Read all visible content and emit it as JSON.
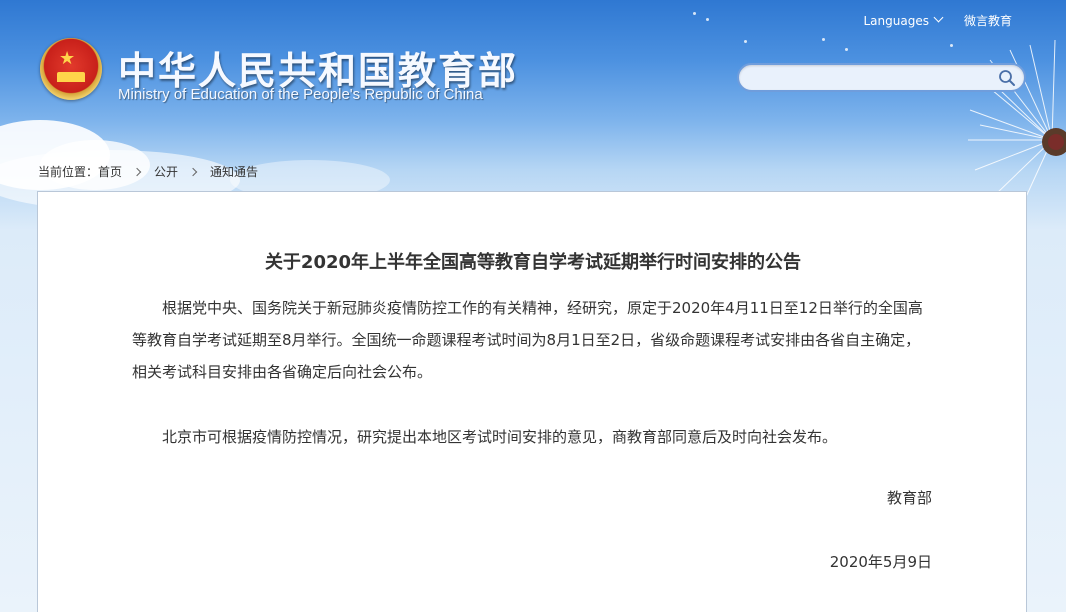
{
  "header": {
    "site_title": "中华人民共和国教育部",
    "site_subtitle": "Ministry of Education of the People's Republic of China",
    "languages_label": "Languages",
    "weibo_label": "微言教育",
    "emblem_icon": "national-emblem-icon"
  },
  "search": {
    "placeholder": "",
    "value": "",
    "icon": "search-icon"
  },
  "breadcrumb": {
    "prefix": "当前位置：",
    "items": [
      "首页",
      "公开",
      "通知通告"
    ]
  },
  "article": {
    "title": "关于2020年上半年全国高等教育自学考试延期举行时间安排的公告",
    "paragraphs": [
      "根据党中央、国务院关于新冠肺炎疫情防控工作的有关精神，经研究，原定于2020年4月11日至12日举行的全国高等教育自学考试延期至8月举行。全国统一命题课程考试时间为8月1日至2日，省级命题课程考试安排由各省自主确定，相关考试科目安排由各省确定后向社会公布。",
      "北京市可根据疫情防控情况，研究提出本地区考试时间安排的意见，商教育部同意后及时向社会发布。"
    ],
    "signature": "教育部",
    "date": "2020年5月9日"
  },
  "colors": {
    "sky_top": "#2f78d2",
    "sky_bottom": "#eaf3fb",
    "text": "#333333",
    "emblem_red": "#c8201a",
    "emblem_gold": "#f0cf6a"
  }
}
